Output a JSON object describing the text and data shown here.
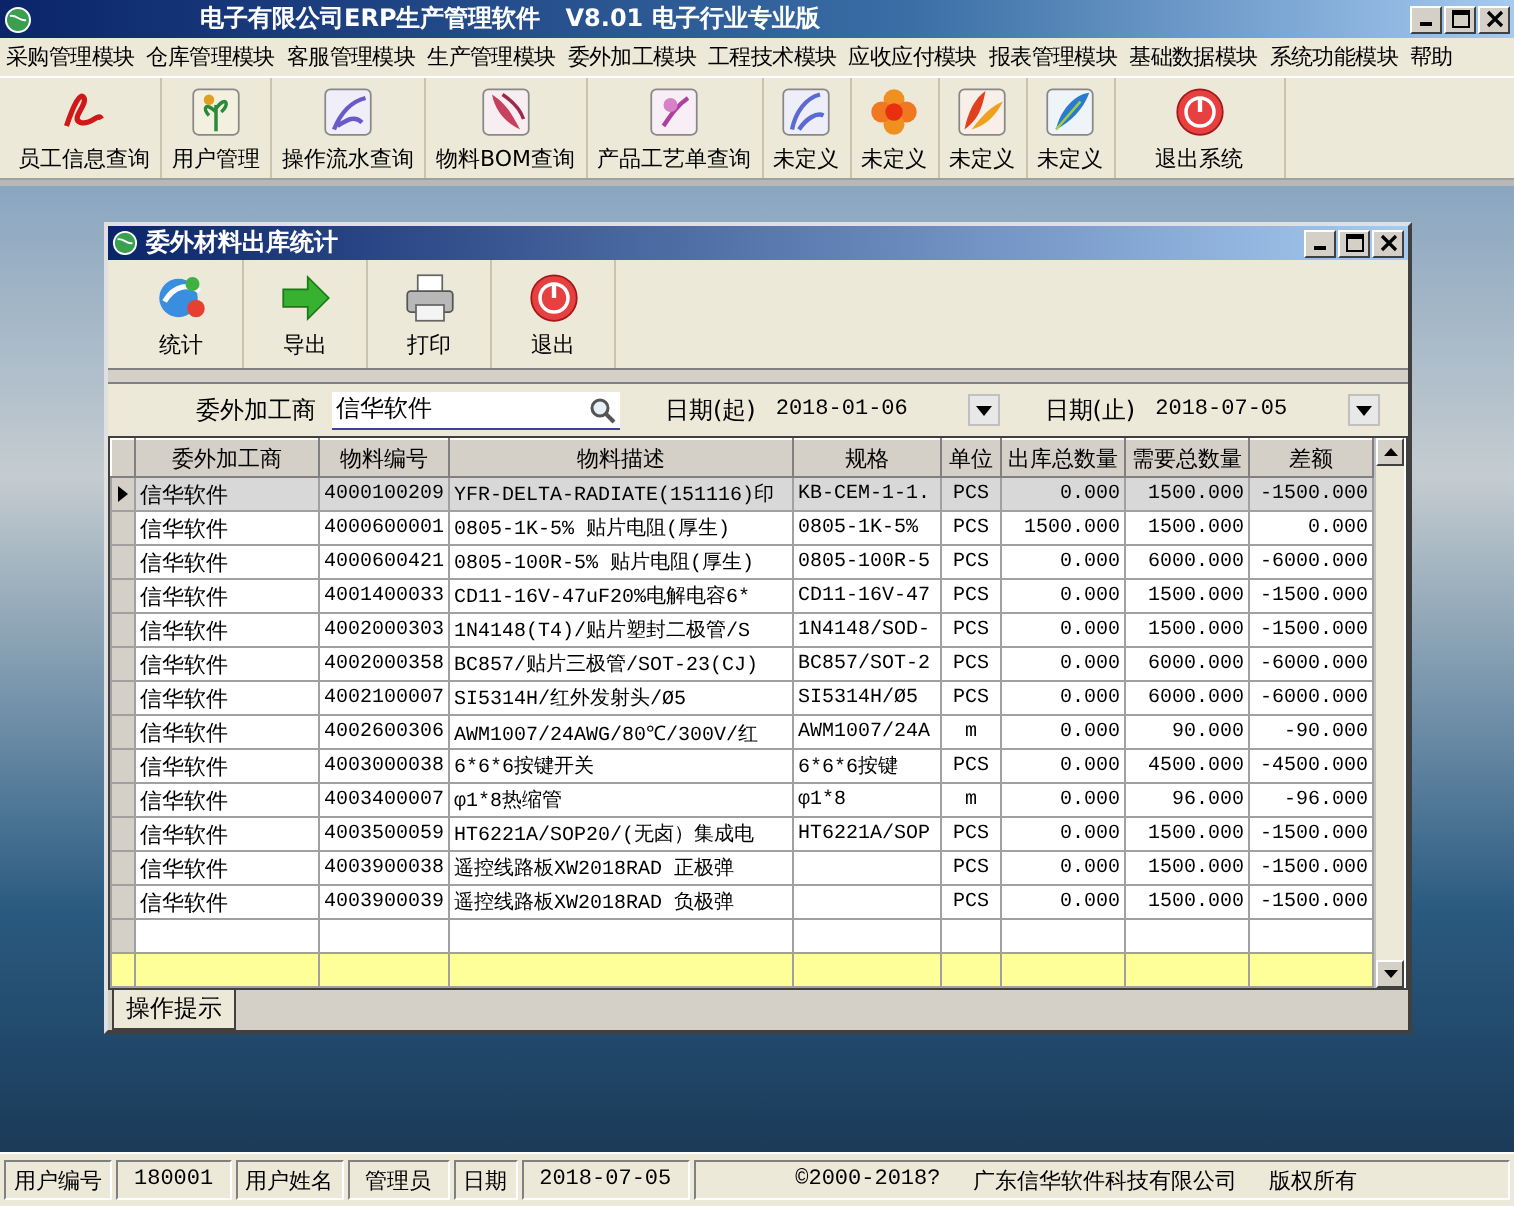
{
  "window": {
    "title": "电子有限公司ERP生产管理软件   V8.01 电子行业专业版"
  },
  "menu": [
    "采购管理模块",
    "仓库管理模块",
    "客服管理模块",
    "生产管理模块",
    "委外加工模块",
    "工程技术模块",
    "应收应付模块",
    "报表管理模块",
    "基础数据模块",
    "系统功能模块",
    "帮助"
  ],
  "toolbar": [
    {
      "label": "员工信息查询"
    },
    {
      "label": "用户管理"
    },
    {
      "label": "操作流水查询"
    },
    {
      "label": "物料BOM查询"
    },
    {
      "label": "产品工艺单查询"
    },
    {
      "label": "未定义"
    },
    {
      "label": "未定义"
    },
    {
      "label": "未定义"
    },
    {
      "label": "未定义"
    },
    {
      "label": "退出系统"
    }
  ],
  "child_window": {
    "title": "委外材料出库统计",
    "toolbar": [
      {
        "label": "统计"
      },
      {
        "label": "导出"
      },
      {
        "label": "打印"
      },
      {
        "label": "退出"
      }
    ],
    "filter": {
      "vendor_label": "委外加工商",
      "vendor_value": "信华软件",
      "start_label": "日期(起)",
      "start_value": "2018-01-06",
      "end_label": "日期(止)",
      "end_value": "2018-07-05"
    },
    "table": {
      "columns": [
        "委外加工商",
        "物料编号",
        "物料描述",
        "规格",
        "单位",
        "出库总数量",
        "需要总数量",
        "差额"
      ],
      "rows": [
        {
          "selected": true,
          "cells": [
            "信华软件",
            "4000100209",
            "YFR-DELTA-RADIATE(151116)印",
            "KB-CEM-1-1.",
            "PCS",
            "0.000",
            "1500.000",
            "-1500.000"
          ]
        },
        {
          "selected": false,
          "cells": [
            "信华软件",
            "4000600001",
            "0805-1K-5% 贴片电阻(厚生)",
            "0805-1K-5%",
            "PCS",
            "1500.000",
            "1500.000",
            "0.000"
          ]
        },
        {
          "selected": false,
          "cells": [
            "信华软件",
            "4000600421",
            "0805-100R-5% 贴片电阻(厚生)",
            "0805-100R-5",
            "PCS",
            "0.000",
            "6000.000",
            "-6000.000"
          ]
        },
        {
          "selected": false,
          "cells": [
            "信华软件",
            "4001400033",
            "CD11-16V-47uF20%电解电容6*",
            "CD11-16V-47",
            "PCS",
            "0.000",
            "1500.000",
            "-1500.000"
          ]
        },
        {
          "selected": false,
          "cells": [
            "信华软件",
            "4002000303",
            "1N4148(T4)/贴片塑封二极管/S",
            "1N4148/SOD-",
            "PCS",
            "0.000",
            "1500.000",
            "-1500.000"
          ]
        },
        {
          "selected": false,
          "cells": [
            "信华软件",
            "4002000358",
            "BC857/贴片三极管/SOT-23(CJ)",
            "BC857/SOT-2",
            "PCS",
            "0.000",
            "6000.000",
            "-6000.000"
          ]
        },
        {
          "selected": false,
          "cells": [
            "信华软件",
            "4002100007",
            "SI5314H/红外发射头/Ø5",
            "SI5314H/Ø5",
            "PCS",
            "0.000",
            "6000.000",
            "-6000.000"
          ]
        },
        {
          "selected": false,
          "cells": [
            "信华软件",
            "4002600306",
            "AWM1007/24AWG/80℃/300V/红",
            "AWM1007/24A",
            "m",
            "0.000",
            "90.000",
            "-90.000"
          ]
        },
        {
          "selected": false,
          "cells": [
            "信华软件",
            "4003000038",
            "6*6*6按键开关",
            "6*6*6按键",
            "PCS",
            "0.000",
            "4500.000",
            "-4500.000"
          ]
        },
        {
          "selected": false,
          "cells": [
            "信华软件",
            "4003400007",
            "φ1*8热缩管",
            "φ1*8",
            "m",
            "0.000",
            "96.000",
            "-96.000"
          ]
        },
        {
          "selected": false,
          "cells": [
            "信华软件",
            "4003500059",
            "HT6221A/SOP20/(无卤）集成电",
            "HT6221A/SOP",
            "PCS",
            "0.000",
            "1500.000",
            "-1500.000"
          ]
        },
        {
          "selected": false,
          "cells": [
            "信华软件",
            "4003900038",
            "遥控线路板XW2018RAD 正极弹",
            "",
            "PCS",
            "0.000",
            "1500.000",
            "-1500.000"
          ]
        },
        {
          "selected": false,
          "cells": [
            "信华软件",
            "4003900039",
            "遥控线路板XW2018RAD 负极弹",
            "",
            "PCS",
            "0.000",
            "1500.000",
            "-1500.000"
          ]
        }
      ]
    },
    "tabs": [
      {
        "label": "操作提示",
        "selected": true
      }
    ]
  },
  "status_bar": {
    "fields": [
      {
        "label": "用户编号",
        "value": "180001"
      },
      {
        "label": "用户姓名",
        "value": "管理员"
      },
      {
        "label": "日期",
        "value": "2018-07-05"
      }
    ],
    "notice": [
      "©2000-2018?",
      "广东信华软件科技有限公司",
      "版权所有"
    ]
  }
}
